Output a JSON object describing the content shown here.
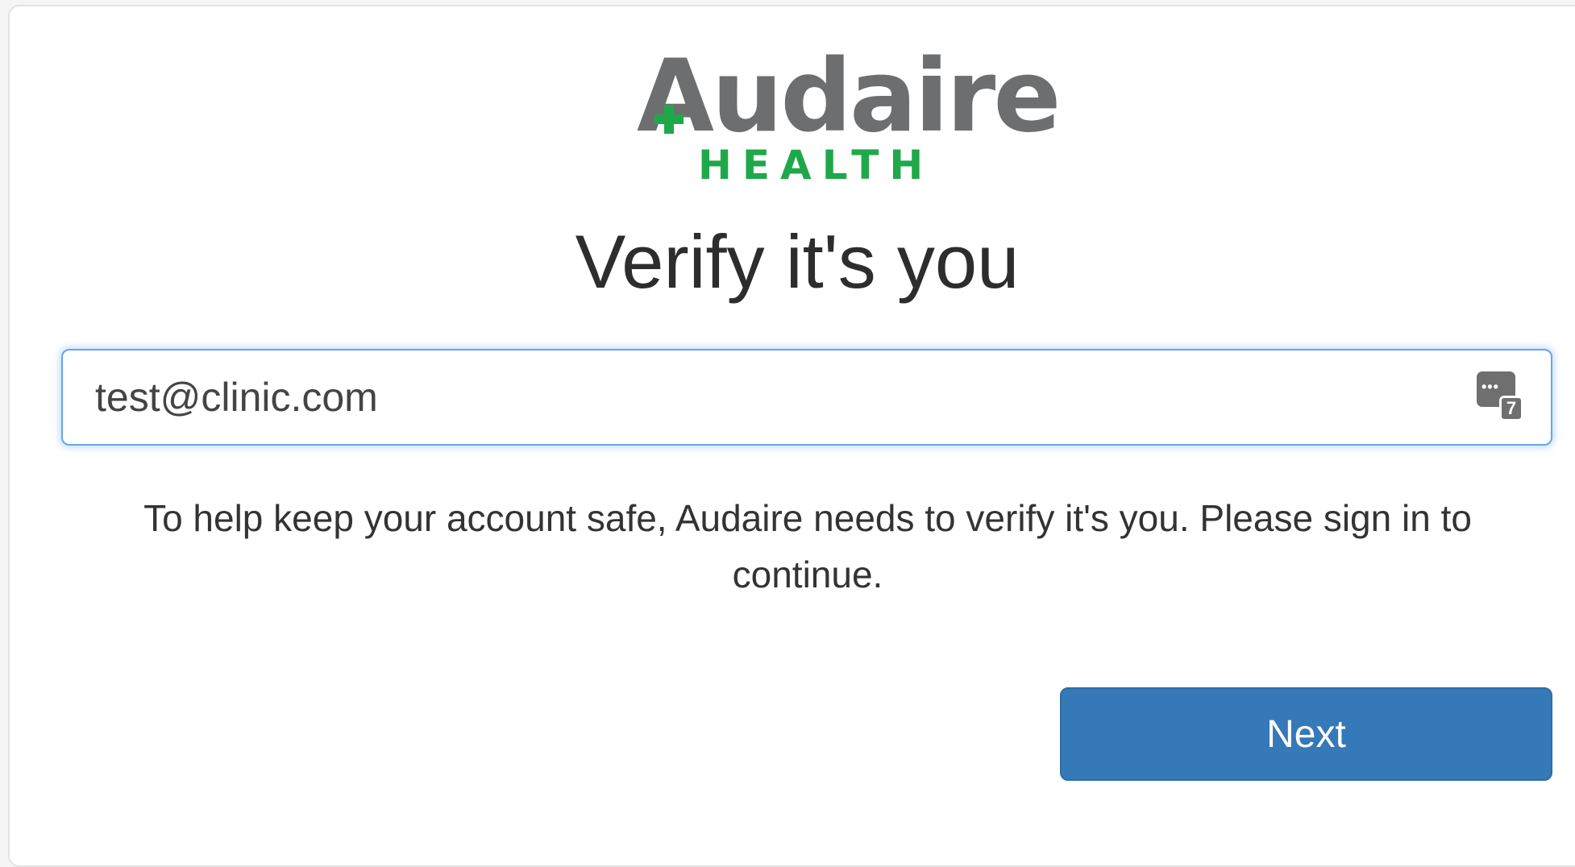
{
  "brand": {
    "name": "Audaire",
    "subtitle": "HEALTH",
    "word_color": "#6d6e70",
    "accent_color": "#1fa84a"
  },
  "page_title": "Verify it's you",
  "email_field": {
    "value": "test@clinic.com",
    "icon": "password-manager-icon",
    "icon_badge": "7"
  },
  "message": "To help keep your account safe, Audaire needs to verify it's you. Please sign in to continue.",
  "next_button": {
    "label": "Next",
    "color": "#3579b8"
  }
}
